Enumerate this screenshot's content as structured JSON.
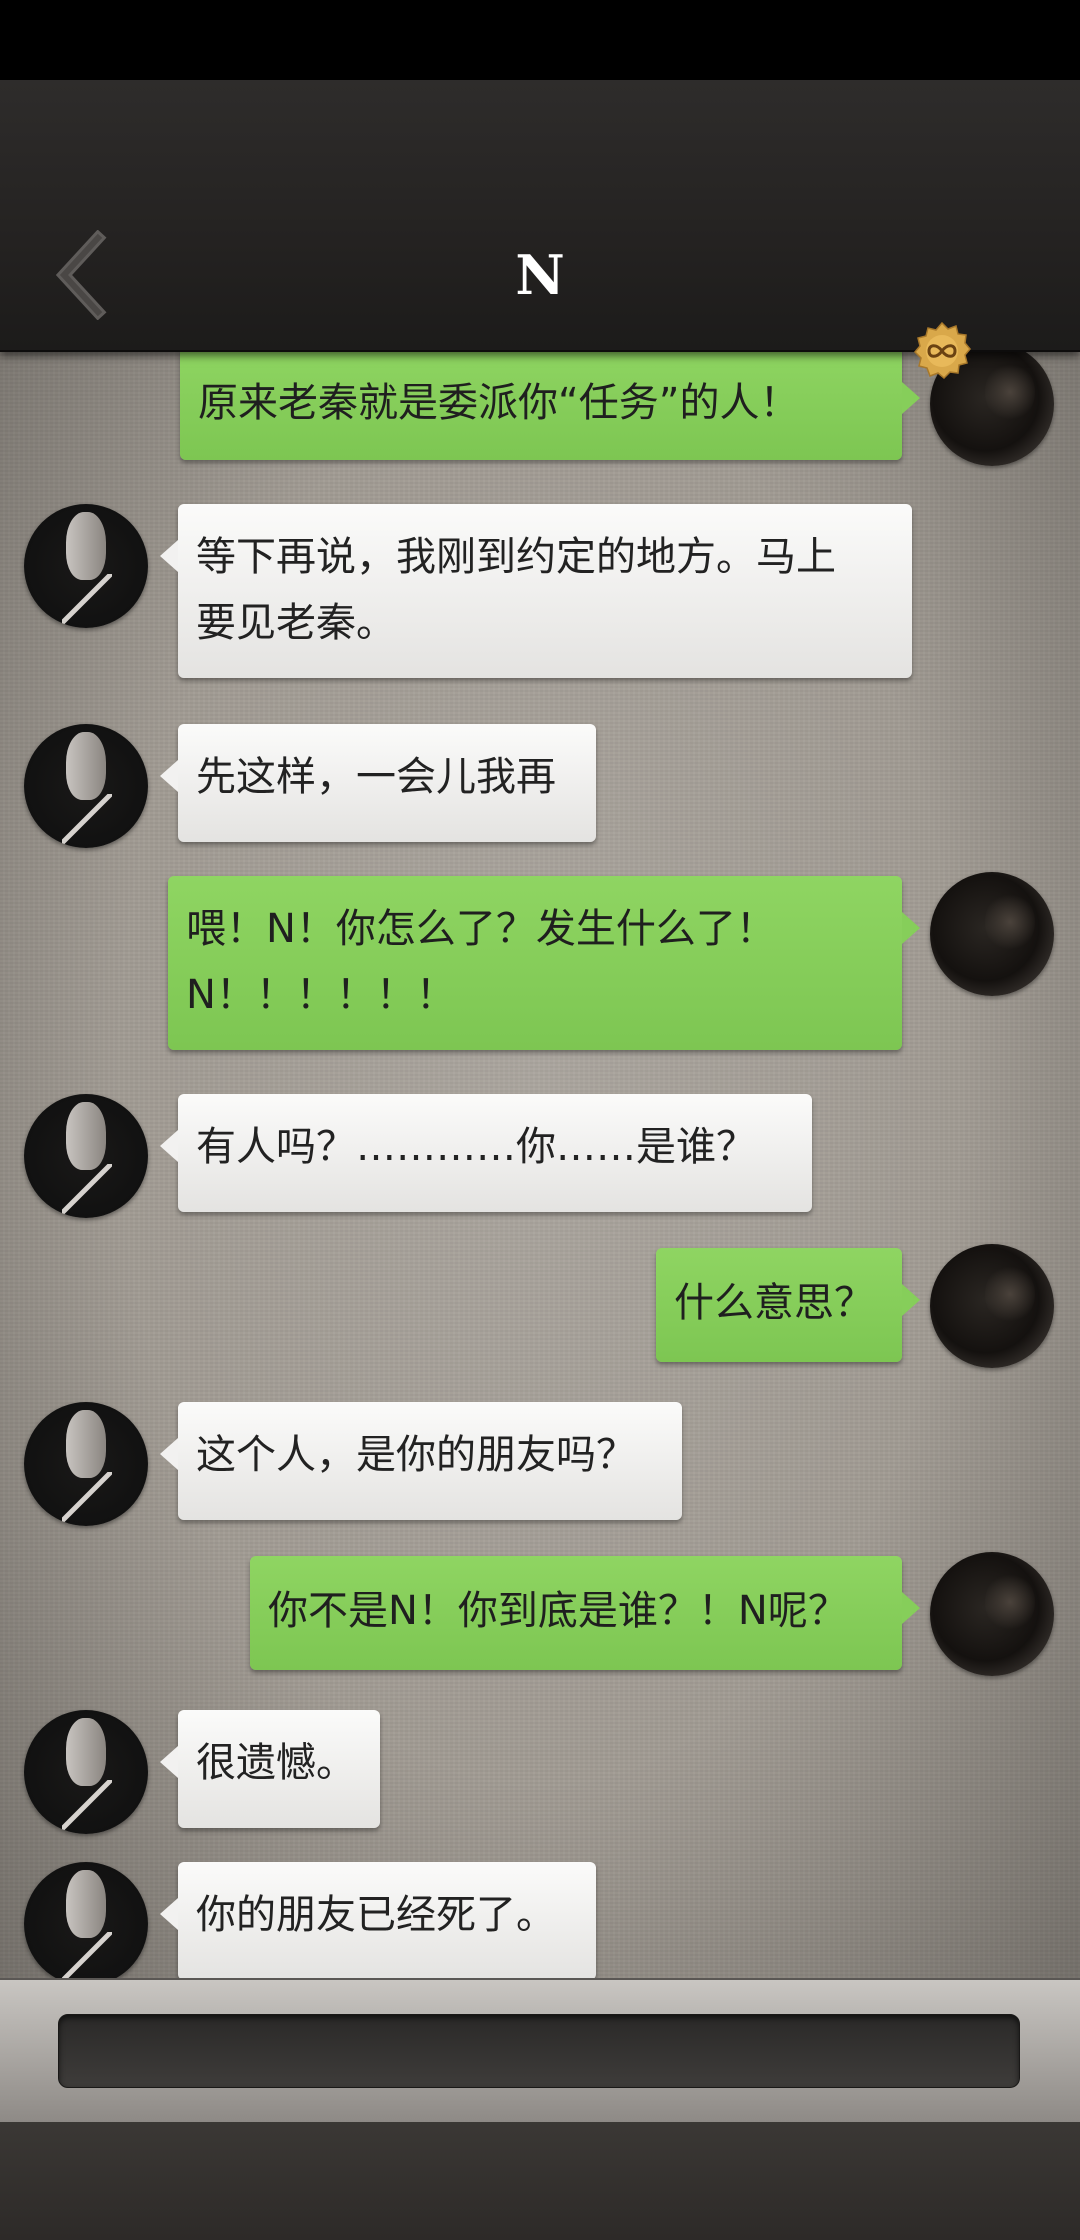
{
  "header": {
    "title": "N",
    "back_icon": "chevron-left-icon",
    "badge_icon": "infinity-badge-icon",
    "badge_color": "#d9a84a"
  },
  "colors": {
    "outgoing_bubble": "#86ce5a",
    "incoming_bubble": "#f0efed",
    "chat_background": "#a29c94"
  },
  "messages": [
    {
      "sender": "me",
      "lines": [
        "原来老秦就是委派你“任务”的人！"
      ]
    },
    {
      "sender": "N",
      "lines": [
        "等下再说，我刚到约定的地方。马上",
        "要见老秦。"
      ]
    },
    {
      "sender": "N",
      "lines": [
        "先这样，一会儿我再"
      ]
    },
    {
      "sender": "me",
      "lines": [
        "喂！N！你怎么了？发生什么了！",
        "N！！！！！！"
      ]
    },
    {
      "sender": "N",
      "lines": [
        "有人吗？…………你……是谁？"
      ]
    },
    {
      "sender": "me",
      "lines": [
        "什么意思？"
      ]
    },
    {
      "sender": "N",
      "lines": [
        "这个人，是你的朋友吗？"
      ]
    },
    {
      "sender": "me",
      "lines": [
        "你不是N！你到底是谁？！N呢？"
      ]
    },
    {
      "sender": "N",
      "lines": [
        "很遗憾。"
      ]
    },
    {
      "sender": "N",
      "lines": [
        "你的朋友已经死了。"
      ]
    }
  ],
  "input": {
    "value": "",
    "placeholder": ""
  }
}
